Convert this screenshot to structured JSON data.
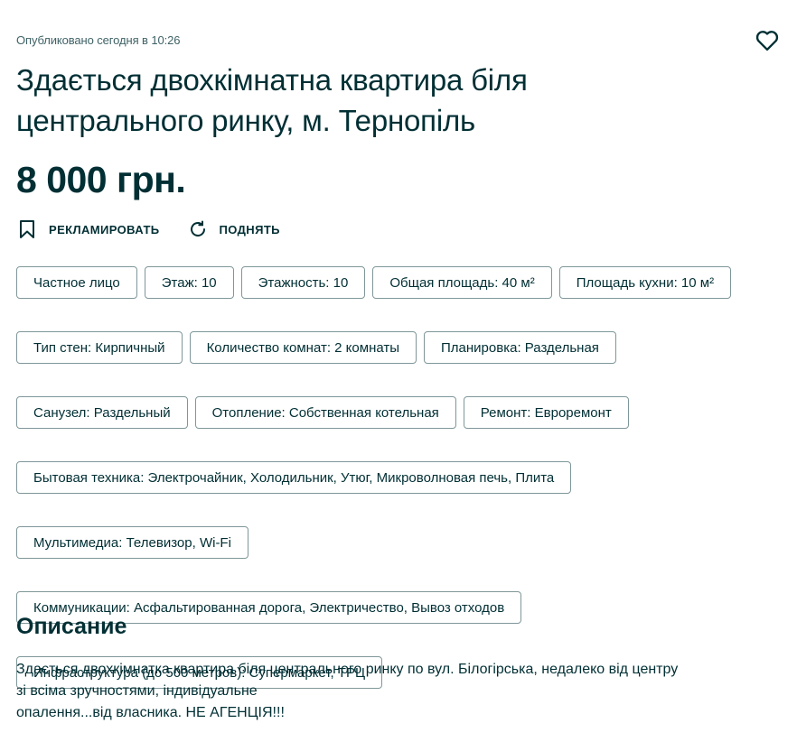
{
  "listing": {
    "published": "Опубликовано сегодня в 10:26",
    "title": "Здається двохкімнатна квартира біля центрального ринку, м. Тернопіль",
    "price": "8 000 грн.",
    "favorite_icon": "heart-outline-icon"
  },
  "actions": {
    "promote_label": "РЕКЛАМИРОВАТЬ",
    "promote_icon": "bookmark-icon",
    "raise_label": "ПОДНЯТЬ",
    "raise_icon": "refresh-icon"
  },
  "tags": [
    "Частное лицо",
    "Этаж: 10",
    "Этажность: 10",
    "Общая площадь: 40 м²",
    "Площадь кухни: 10 м²",
    "Тип стен: Кирпичный",
    "Количество комнат: 2 комнаты",
    "Планировка: Раздельная",
    "Санузел: Раздельный",
    "Отопление: Собственная котельная",
    "Ремонт: Евроремонт",
    "Бытовая техника: Электрочайник, Холодильник, Утюг, Микроволновая печь, Плита",
    "Мультимедиа: Телевизор, Wi-Fi",
    "Коммуникации: Асфальтированная дорога, Электричество, Вывоз отходов",
    "Инфраструктура (до 500 метров): Супермаркет, ТРЦ"
  ],
  "description": {
    "heading": "Описание",
    "line1": "Здається двохкімнатка квартира біля центрального ринку по вул. Білогірська, недалеко від центру",
    "line2": "зі всіма зручностями, індивідуальне",
    "line3": "опалення...від власника. НЕ АГЕНЦІЯ!!!"
  },
  "colors": {
    "text": "#002f34",
    "muted": "#406367",
    "border": "#7f9799"
  }
}
